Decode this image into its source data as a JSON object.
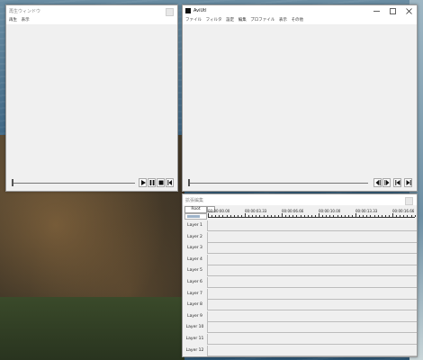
{
  "playback_window": {
    "title": "再生ウィンドウ",
    "menu": [
      "再生",
      "表示"
    ],
    "slider_position": 0.0,
    "buttons": [
      {
        "name": "play-icon"
      },
      {
        "name": "pause-icon"
      },
      {
        "name": "stop-icon"
      },
      {
        "name": "frame-back-icon"
      }
    ]
  },
  "main_window": {
    "title": "AviUtl",
    "menu": [
      "ファイル",
      "フィルタ",
      "設定",
      "編集",
      "プロファイル",
      "表示",
      "その他"
    ],
    "caption_buttons": [
      "minimize-icon",
      "maximize-icon",
      "close-icon"
    ],
    "seek_position": 0.0,
    "nav_buttons": [
      {
        "name": "step-back-icon"
      },
      {
        "name": "step-forward-icon"
      },
      {
        "name": "go-start-icon"
      },
      {
        "name": "go-end-icon"
      }
    ]
  },
  "timeline_window": {
    "title": "拡張編集",
    "root_label": "Root",
    "timecodes": [
      "00:00:00.00",
      "00:00:03.33",
      "00:00:06.66",
      "00:00:10.00",
      "00:00:13.33",
      "00:00:16.66"
    ],
    "layers": [
      "Layer 1",
      "Layer 2",
      "Layer 3",
      "Layer 4",
      "Layer 5",
      "Layer 6",
      "Layer 7",
      "Layer 8",
      "Layer 9",
      "Layer 10",
      "Layer 11",
      "Layer 12"
    ]
  },
  "colors": {
    "window_bg": "#f0f0f0",
    "titlebar_bg": "#ffffff",
    "scale_fill": "#9eb3c9"
  }
}
